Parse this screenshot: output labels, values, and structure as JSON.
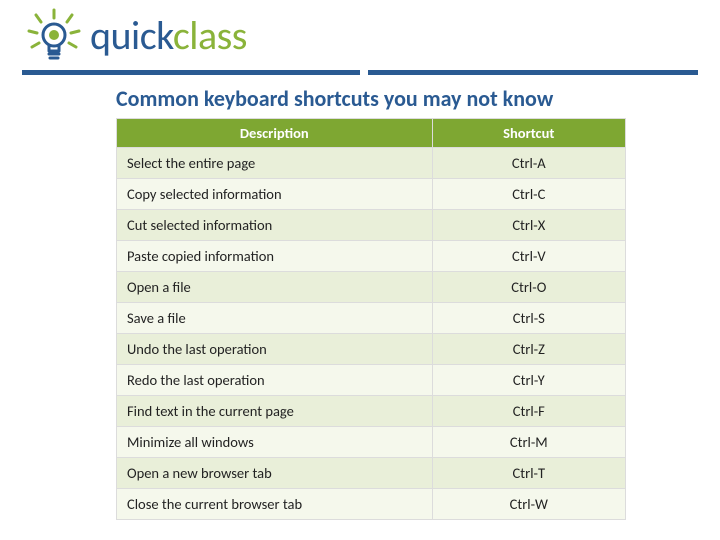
{
  "brand": {
    "part1": "quick",
    "part2": "class"
  },
  "title": "Common keyboard shortcuts you may not know",
  "headers": {
    "desc": "Description",
    "shortcut": "Shortcut"
  },
  "rows": [
    {
      "desc": "Select the entire page",
      "shortcut": "Ctrl-A"
    },
    {
      "desc": "Copy selected information",
      "shortcut": "Ctrl-C"
    },
    {
      "desc": "Cut selected information",
      "shortcut": "Ctrl-X"
    },
    {
      "desc": "Paste copied information",
      "shortcut": "Ctrl-V"
    },
    {
      "desc": "Open a file",
      "shortcut": "Ctrl-O"
    },
    {
      "desc": "Save a file",
      "shortcut": "Ctrl-S"
    },
    {
      "desc": "Undo the last operation",
      "shortcut": "Ctrl-Z"
    },
    {
      "desc": "Redo the last operation",
      "shortcut": "Ctrl-Y"
    },
    {
      "desc": "Find text in the current page",
      "shortcut": "Ctrl-F"
    },
    {
      "desc": "Minimize all windows",
      "shortcut": "Ctrl-M"
    },
    {
      "desc": "Open a new browser tab",
      "shortcut": "Ctrl-T"
    },
    {
      "desc": "Close the current browser tab",
      "shortcut": "Ctrl-W"
    }
  ]
}
